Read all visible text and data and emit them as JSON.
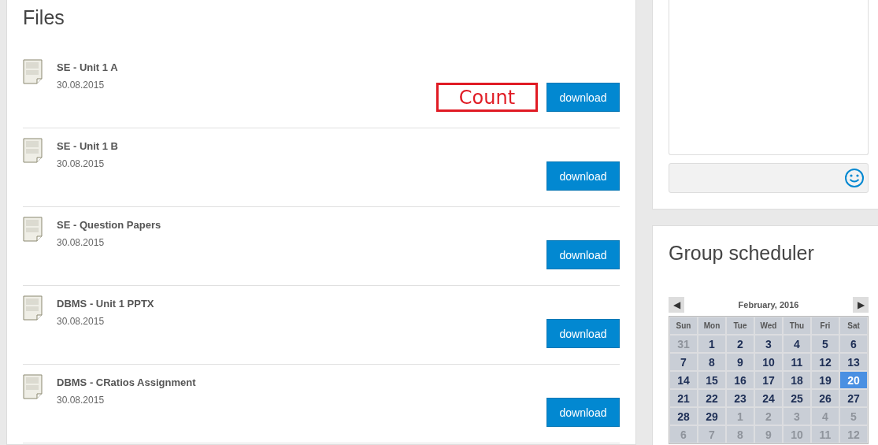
{
  "files": {
    "title": "Files",
    "items": [
      {
        "name": "SE - Unit 1 A",
        "date": "30.08.2015",
        "button": "download",
        "annotation": "Count"
      },
      {
        "name": "SE - Unit 1 B",
        "date": "30.08.2015",
        "button": "download"
      },
      {
        "name": "SE - Question Papers",
        "date": "30.08.2015",
        "button": "download"
      },
      {
        "name": "DBMS - Unit 1 PPTX",
        "date": "30.08.2015",
        "button": "download"
      },
      {
        "name": "DBMS - CRatios Assignment",
        "date": "30.08.2015",
        "button": "download"
      }
    ]
  },
  "chat": {
    "message_field": {
      "emoji": true
    }
  },
  "scheduler": {
    "title": "Group scheduler",
    "calendar": {
      "prev": "◀",
      "next": "▶",
      "month": "February, 2016",
      "weekdays": [
        "Sun",
        "Mon",
        "Tue",
        "Wed",
        "Thu",
        "Fri",
        "Sat"
      ],
      "weeks": [
        [
          {
            "day": "31",
            "other": true,
            "selected": false
          },
          {
            "day": "1",
            "other": false,
            "selected": false
          },
          {
            "day": "2",
            "other": false,
            "selected": false
          },
          {
            "day": "3",
            "other": false,
            "selected": false
          },
          {
            "day": "4",
            "other": false,
            "selected": false
          },
          {
            "day": "5",
            "other": false,
            "selected": false
          },
          {
            "day": "6",
            "other": false,
            "selected": false
          }
        ],
        [
          {
            "day": "7",
            "other": false,
            "selected": false
          },
          {
            "day": "8",
            "other": false,
            "selected": false
          },
          {
            "day": "9",
            "other": false,
            "selected": false
          },
          {
            "day": "10",
            "other": false,
            "selected": false
          },
          {
            "day": "11",
            "other": false,
            "selected": false
          },
          {
            "day": "12",
            "other": false,
            "selected": false
          },
          {
            "day": "13",
            "other": false,
            "selected": false
          }
        ],
        [
          {
            "day": "14",
            "other": false,
            "selected": false
          },
          {
            "day": "15",
            "other": false,
            "selected": false
          },
          {
            "day": "16",
            "other": false,
            "selected": false
          },
          {
            "day": "17",
            "other": false,
            "selected": false
          },
          {
            "day": "18",
            "other": false,
            "selected": false
          },
          {
            "day": "19",
            "other": false,
            "selected": false
          },
          {
            "day": "20",
            "other": false,
            "selected": true
          }
        ],
        [
          {
            "day": "21",
            "other": false,
            "selected": false
          },
          {
            "day": "22",
            "other": false,
            "selected": false
          },
          {
            "day": "23",
            "other": false,
            "selected": false
          },
          {
            "day": "24",
            "other": false,
            "selected": false
          },
          {
            "day": "25",
            "other": false,
            "selected": false
          },
          {
            "day": "26",
            "other": false,
            "selected": false
          },
          {
            "day": "27",
            "other": false,
            "selected": false
          }
        ],
        [
          {
            "day": "28",
            "other": false,
            "selected": false
          },
          {
            "day": "29",
            "other": false,
            "selected": false
          },
          {
            "day": "1",
            "other": true,
            "selected": false
          },
          {
            "day": "2",
            "other": true,
            "selected": false
          },
          {
            "day": "3",
            "other": true,
            "selected": false
          },
          {
            "day": "4",
            "other": true,
            "selected": false
          },
          {
            "day": "5",
            "other": true,
            "selected": false
          }
        ],
        [
          {
            "day": "6",
            "other": true,
            "selected": false
          },
          {
            "day": "7",
            "other": true,
            "selected": false
          },
          {
            "day": "8",
            "other": true,
            "selected": false
          },
          {
            "day": "9",
            "other": true,
            "selected": false
          },
          {
            "day": "10",
            "other": true,
            "selected": false
          },
          {
            "day": "11",
            "other": true,
            "selected": false
          },
          {
            "day": "12",
            "other": true,
            "selected": false
          }
        ]
      ]
    }
  }
}
